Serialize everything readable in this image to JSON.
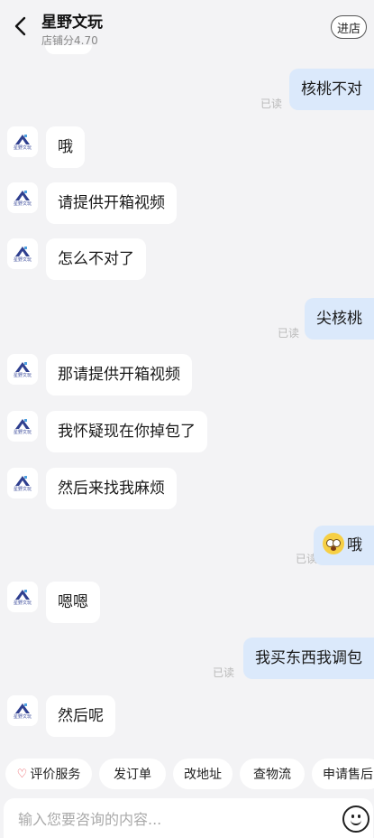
{
  "header": {
    "shop_name": "星野文玩",
    "shop_score": "店铺分4.70",
    "enter_label": "进店"
  },
  "avatar": {
    "logo_text": "星野文玩"
  },
  "messages": [
    {
      "side": "out",
      "text": "核桃不对",
      "read": "已读"
    },
    {
      "side": "in",
      "text": "哦"
    },
    {
      "side": "in",
      "text": "请提供开箱视频"
    },
    {
      "side": "in",
      "text": "怎么不对了"
    },
    {
      "side": "out",
      "text": "尖核桃",
      "read": "已读"
    },
    {
      "side": "in",
      "text": "那请提供开箱视频"
    },
    {
      "side": "in",
      "text": "我怀疑现在你掉包了"
    },
    {
      "side": "in",
      "text": "然后来找我麻烦"
    },
    {
      "side": "out",
      "text": "哦",
      "emoji": "rolling-eyes-emoji",
      "read": "已读"
    },
    {
      "side": "in",
      "text": "嗯嗯"
    },
    {
      "side": "out",
      "text": "我买东西我调包",
      "read": "已读"
    },
    {
      "side": "in",
      "text": "然后呢"
    }
  ],
  "quick_actions": [
    "评价服务",
    "发订单",
    "改地址",
    "查物流",
    "申请售后"
  ],
  "input": {
    "placeholder": "输入您要咨询的内容..."
  },
  "colors": {
    "background": "#f3f3f5",
    "incoming_bubble": "#ffffff",
    "outgoing_bubble": "#dbe9fb",
    "heart": "#e8434b"
  }
}
